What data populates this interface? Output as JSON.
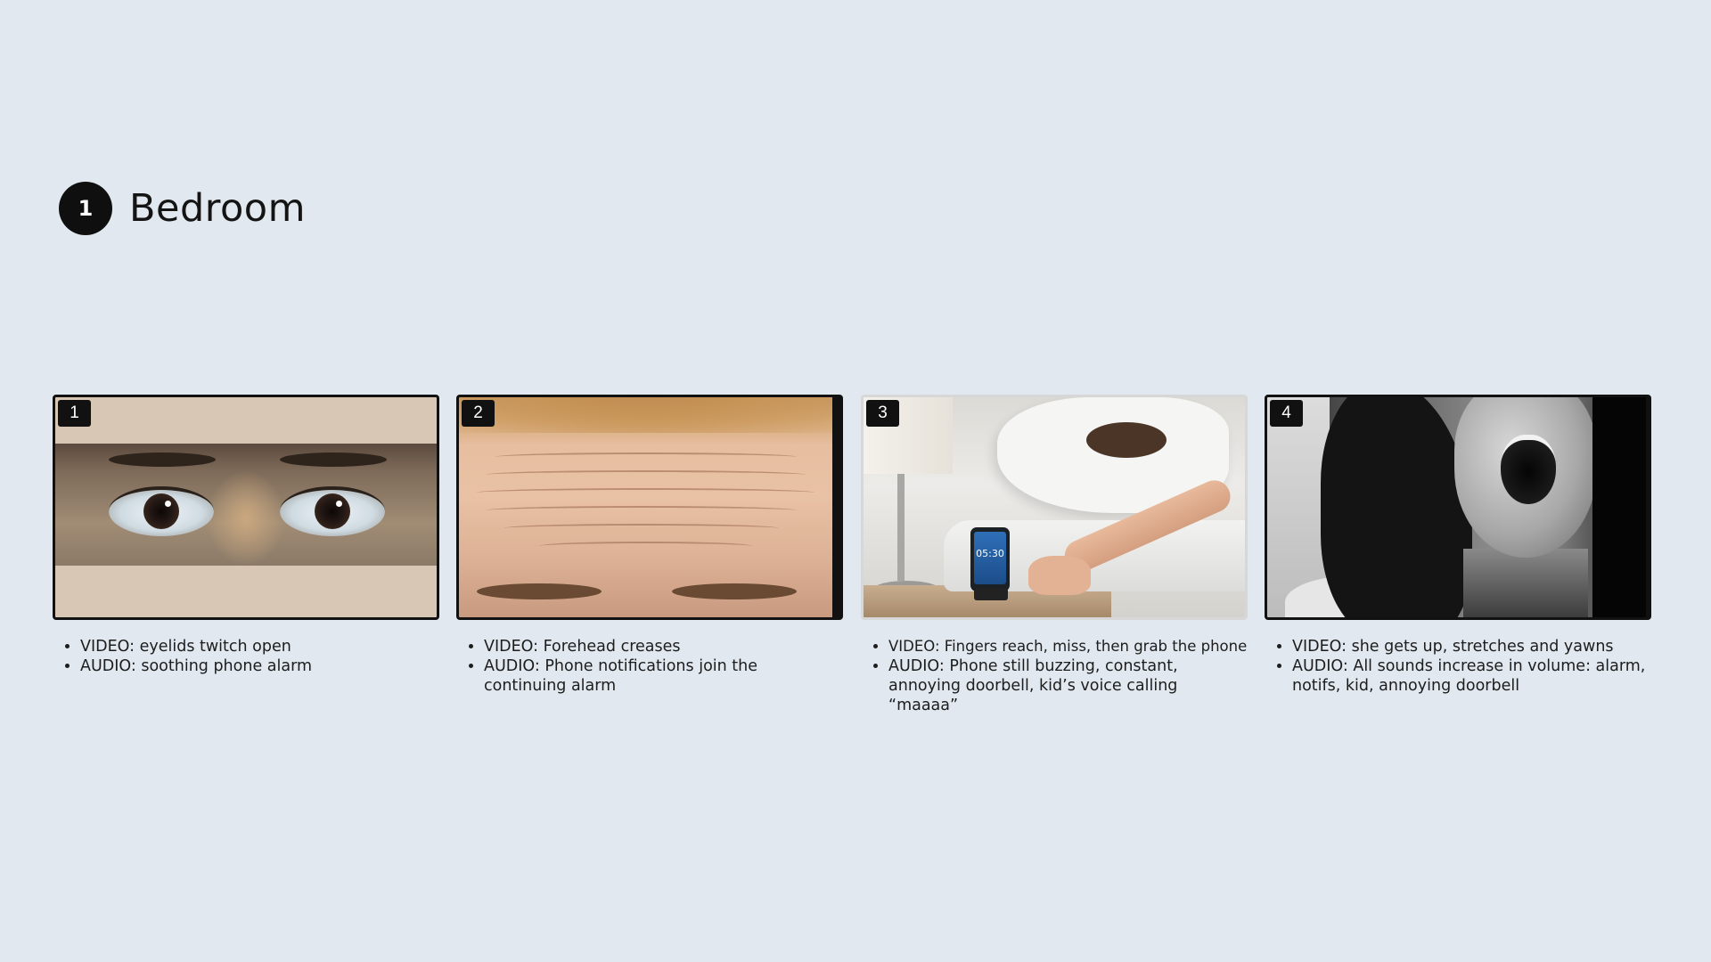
{
  "scene": {
    "number": "1",
    "title": "Bedroom"
  },
  "panels": [
    {
      "number": "1",
      "image": "eyes-closeup",
      "notes": [
        "VIDEO: eyelids twitch open",
        "AUDIO: soothing phone alarm"
      ]
    },
    {
      "number": "2",
      "image": "forehead-creases",
      "notes": [
        "VIDEO: Forehead creases",
        "AUDIO: Phone notifications join the continuing alarm"
      ]
    },
    {
      "number": "3",
      "image": "hand-reaching-phone",
      "phone_time": "05:30",
      "notes": [
        "VIDEO: Fingers reach, miss, then grab the phone",
        "AUDIO: Phone still buzzing, constant, annoying doorbell, kid’s voice calling “maaaa”"
      ]
    },
    {
      "number": "4",
      "image": "woman-yawning",
      "notes": [
        "VIDEO: she gets up, stretches and yawns",
        "AUDIO: All sounds increase in volume: alarm, notifs, kid, annoying doorbell"
      ]
    }
  ]
}
